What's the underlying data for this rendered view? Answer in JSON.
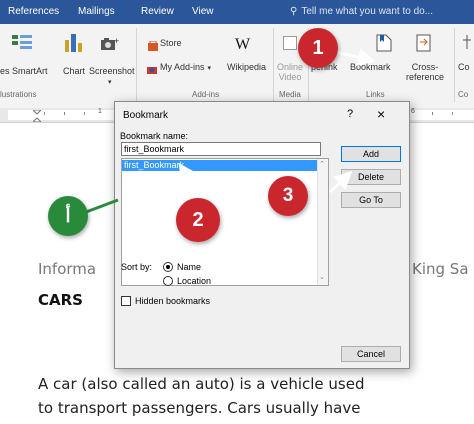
{
  "ribbon": {
    "tabs": [
      "References",
      "Mailings",
      "Review",
      "View"
    ],
    "tell_me": "Tell me what you want to do...",
    "buttons": {
      "smartart": "es SmartArt",
      "chart": "Chart",
      "screenshot": "Screenshot",
      "store": "Store",
      "my_addins": "My Add-ins",
      "wikipedia": "Wikipedia",
      "online_video_1": "Online",
      "online_video_2": "Video",
      "hyperlink": "perlink",
      "bookmark": "Bookmark",
      "cross_reference_1": "Cross-",
      "cross_reference_2": "reference",
      "comment": "Co"
    },
    "groups": {
      "illustrations": "lustrations",
      "addins": "Add-ins",
      "media": "Media",
      "links": "Links",
      "comments": "Co"
    }
  },
  "ruler": {
    "numbers": [
      "1",
      "6"
    ]
  },
  "document": {
    "line_left": "Informa",
    "line_right": "King Sa",
    "heading": "CARS",
    "para_line1": "A car (also called an auto) is a vehicle used",
    "para_line2": "to transport passengers. Cars usually have"
  },
  "dialog": {
    "title": "Bookmark",
    "help": "?",
    "close": "×",
    "name_label": "Bookmark name:",
    "name_value": "first_Bookmark",
    "list_items": [
      "first_Bookmark"
    ],
    "buttons": {
      "add": "Add",
      "delete": "Delete",
      "goto": "Go To",
      "cancel": "Cancel"
    },
    "sort_by_label": "Sort by:",
    "sort_options": [
      "Name",
      "Location"
    ],
    "sort_selected": "Name",
    "hidden_label": "Hidden bookmarks"
  },
  "callouts": {
    "c1": "1",
    "c2": "2",
    "c3": "3",
    "arabic": "أ"
  },
  "colors": {
    "ribbon_blue": "#2b579a",
    "callout_red": "#c9272d",
    "callout_green": "#2a8a3c",
    "selection": "#3399ff"
  }
}
